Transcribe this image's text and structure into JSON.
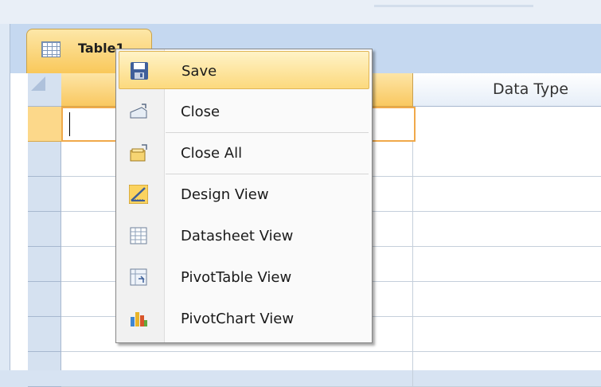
{
  "tab": {
    "label": "Table1"
  },
  "columns": {
    "data_type": "Data Type"
  },
  "context_menu": {
    "items": [
      {
        "label": "Save",
        "icon": "save-icon"
      },
      {
        "label": "Close",
        "icon": "close-icon"
      },
      {
        "label": "Close All",
        "icon": "close-all-icon"
      },
      {
        "label": "Design View",
        "icon": "design-view-icon"
      },
      {
        "label": "Datasheet View",
        "icon": "datasheet-view-icon"
      },
      {
        "label": "PivotTable View",
        "icon": "pivottable-view-icon"
      },
      {
        "label": "PivotChart View",
        "icon": "pivotchart-view-icon"
      }
    ]
  },
  "colors": {
    "highlight": "#fcd97d",
    "tab": "#f9c85a",
    "chrome": "#c5d8f0"
  }
}
